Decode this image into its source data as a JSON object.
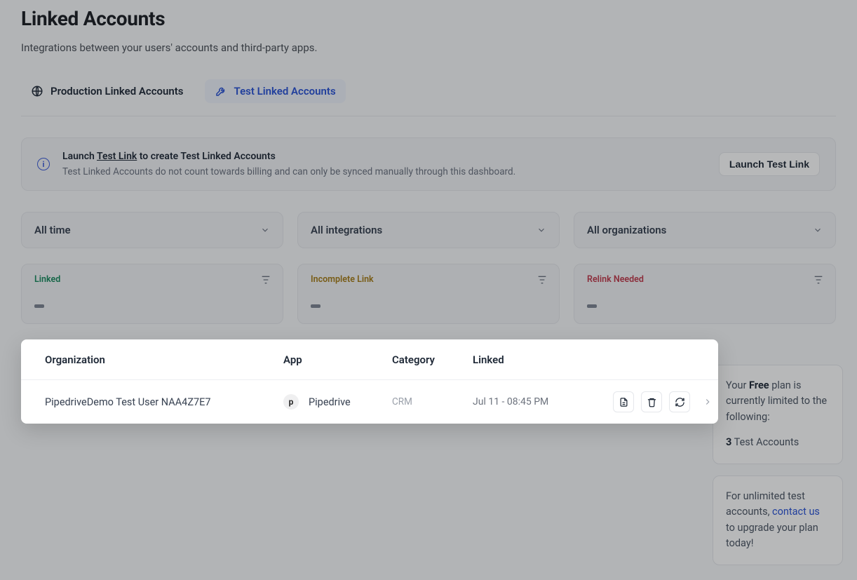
{
  "header": {
    "title": "Linked Accounts",
    "subtitle": "Integrations between your users' accounts and third-party apps."
  },
  "tabs": {
    "production": "Production Linked Accounts",
    "test": "Test Linked Accounts"
  },
  "notice": {
    "title_pre": "Launch ",
    "title_link": "Test Link",
    "title_post": " to create Test Linked Accounts",
    "desc": "Test Linked Accounts do not count towards billing and can only be synced manually through this dashboard.",
    "button": "Launch Test Link"
  },
  "filters": {
    "time": "All time",
    "integrations": "All integrations",
    "organizations": "All organizations"
  },
  "status": {
    "linked": "Linked",
    "incomplete": "Incomplete Link",
    "relink": "Relink Needed"
  },
  "table": {
    "headers": {
      "org": "Organization",
      "app": "App",
      "category": "Category",
      "linked": "Linked"
    },
    "rows": [
      {
        "org": "PipedriveDemo Test User NAA4Z7E7",
        "app": "Pipedrive",
        "app_initial": "p",
        "category": "CRM",
        "linked": "Jul 11 - 08:45 PM"
      }
    ]
  },
  "plan_card": {
    "line1_pre": "Your ",
    "line1_bold": "Free",
    "line1_post": " plan is currently limited to the following:",
    "count": "3",
    "count_label": " Test Accounts"
  },
  "upgrade_card": {
    "pre": "For unlimited test accounts, ",
    "link": "contact us",
    "post": " to upgrade your plan today!"
  }
}
